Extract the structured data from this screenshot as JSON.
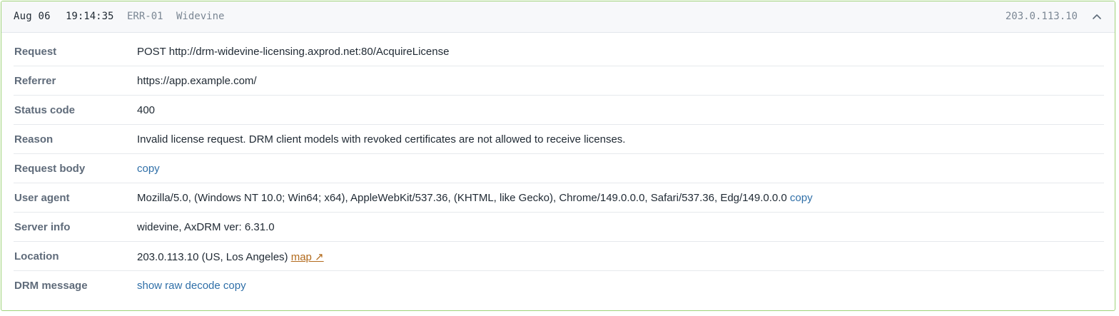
{
  "header": {
    "date": "Aug 06",
    "time": "19:14:35",
    "code": "ERR-01",
    "system": "Widevine",
    "ip": "203.0.113.10",
    "collapse_icon": "chevron-up-icon"
  },
  "rows": {
    "request": {
      "label": "Request",
      "value": "POST http://drm-widevine-licensing.axprod.net:80/AcquireLicense"
    },
    "referrer": {
      "label": "Referrer",
      "value": "https://app.example.com/"
    },
    "status": {
      "label": "Status code",
      "value": "400"
    },
    "reason": {
      "label": "Reason",
      "value": "Invalid license request. DRM client models with revoked certificates are not allowed to receive licenses."
    },
    "body": {
      "label": "Request body",
      "copy": "copy"
    },
    "ua": {
      "label": "User agent",
      "value": "Mozilla/5.0, (Windows NT 10.0; Win64; x64), AppleWebKit/537.36, (KHTML, like Gecko), Chrome/149.0.0.0, Safari/537.36, Edg/149.0.0.0",
      "copy": "copy"
    },
    "server": {
      "label": "Server info",
      "value": "widevine, AxDRM ver: 6.31.0"
    },
    "location": {
      "label": "Location",
      "value": "203.0.113.10 (US, Los Angeles)",
      "map": "map ↗"
    },
    "drm": {
      "label": "DRM message",
      "raw": "show raw",
      "decode": "decode",
      "copy": "copy"
    }
  },
  "colors": {
    "border": "#9fd37a",
    "link": "#2f6fa8",
    "map_link": "#b26a1c",
    "label": "#5f6b7a"
  }
}
